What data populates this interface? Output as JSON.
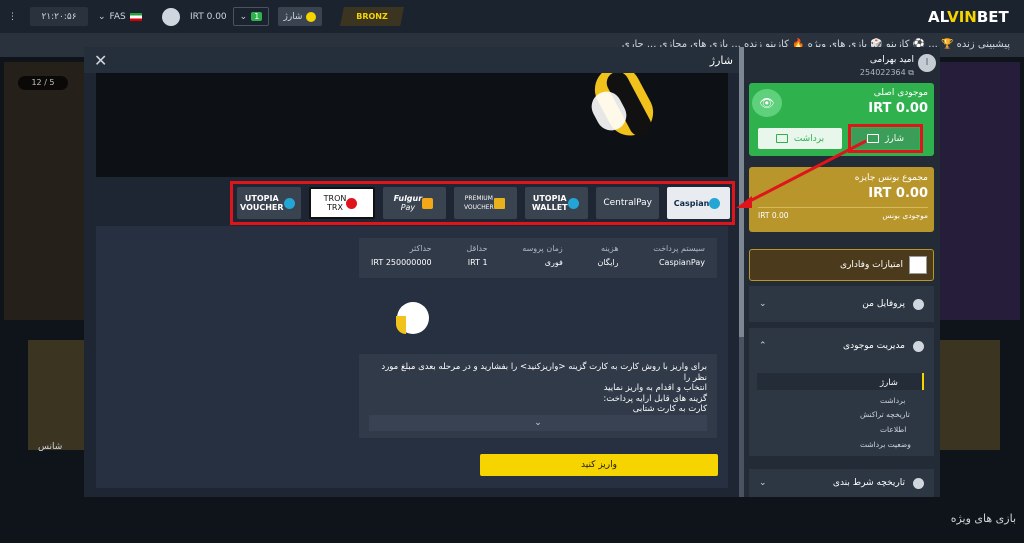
{
  "topbar": {
    "clock": "۲۱:۲۰:۵۶",
    "language": "FAS",
    "balance": "IRT 0.00",
    "notif_count": "1",
    "charge_label": "شارژ",
    "rank": "BRONZ",
    "logo_left": "AL",
    "logo_mid": "VIN",
    "logo_right": "BET"
  },
  "ticker": "پیشبینی زنده   🏆   ...   ⚽   کازینو   🎲   بازی های ویژه   🔥   کازینو زنده   ...   بازی های مجازی   ...   جاری",
  "background": {
    "counter": "12 / 5",
    "tile_left_label": "شانس",
    "featured_label": "بازی های ویژه"
  },
  "modal": {
    "title": "شارژ",
    "close_glyph": "✕",
    "methods": [
      {
        "line1": "Caspian",
        "line2": "",
        "key": "caspian"
      },
      {
        "line1": "CentralPay",
        "line2": "",
        "key": "centralpay"
      },
      {
        "line1": "UTOPIA",
        "line2": "WALLET",
        "key": "utopia-wallet"
      },
      {
        "line1": "PREMIUM",
        "line2": "VOUCHER",
        "key": "premium"
      },
      {
        "line1": "Fulgur",
        "line2": "Pay",
        "key": "fulgur"
      },
      {
        "line1": "TRON",
        "line2": "TRX",
        "key": "tron"
      },
      {
        "line1": "UTOPIA",
        "line2": "VOUCHER",
        "key": "utopia-voucher"
      }
    ],
    "info": {
      "headers": [
        "سیستم پرداخت",
        "هزینه",
        "زمان پروسه",
        "حداقل",
        "حداکثر"
      ],
      "values": [
        "CaspianPay",
        "رایگان",
        "فوری",
        "IRT 1",
        "IRT 250000000"
      ]
    },
    "instructions": [
      "برای واریز با روش کارت به کارت گزینه <واریزکنید> را بفشارید و در مرحله بعدی مبلغ مورد نظر را",
      "انتخاب و اقدام به واریز نمایید",
      "گزینه های قابل ارایه پرداخت:",
      "کارت به کارت شتابی"
    ],
    "select_chevron": "⌄",
    "deposit_button": "واریز کنید"
  },
  "panel": {
    "avatar_initial": "ا",
    "user_name": "امید بهرامی",
    "user_id": "254022364",
    "main_balance_label": "موجودی اصلی",
    "main_balance": "IRT 0.00",
    "withdraw_label": "برداشت",
    "charge_label": "شارژ",
    "bonus_label": "مجموع بونس جایزه",
    "bonus_amount": "IRT 0.00",
    "bonus_sub_left": "IRT 0.00",
    "bonus_sub_right": "موجودی بونس",
    "loyalty_label": "امتیازات وفاداری",
    "profile_label": "پروفایل من",
    "wallet_label": "مدیریت موجودی",
    "wallet_items": [
      "شارژ",
      "برداشت",
      "تاریخچه تراکنش",
      "اطلاعات",
      "وضعیت برداشت"
    ],
    "bet_history_label": "تاریخچه شرط بندی"
  },
  "colors": {
    "accent_yellow": "#f5d400",
    "green": "#2fb24e",
    "gold": "#b8962c",
    "highlight_red": "#e0151b"
  }
}
